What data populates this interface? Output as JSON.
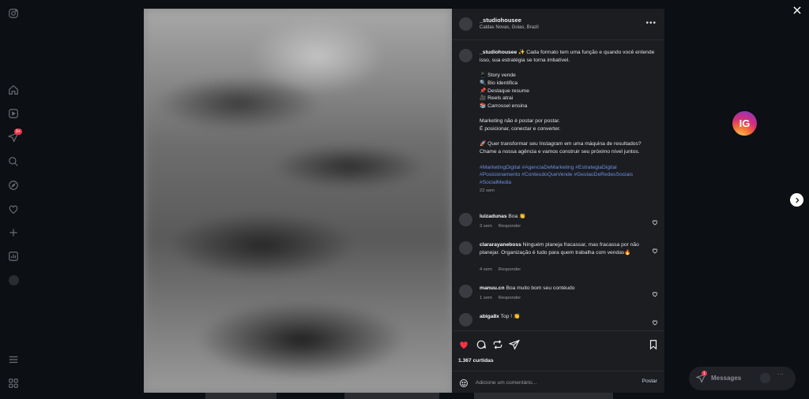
{
  "post": {
    "author": "_studiohousee",
    "location": "Caldas Novas, Goias, Brazil",
    "caption_author": "_studiohousee",
    "caption_intro": "✨ Cada formato tem uma função e quando você entende isso, sua estratégia se torna imbatível.",
    "caption_list": "📱 Story vende\n🔍 Bio identifica\n📌 Destaque resume\n🎥 Reels atrai\n📚 Carrossel ensina",
    "caption_p2": "Marketing não é postar por postar.\nÉ posicionar, conectar e converter.",
    "caption_p3": "🚀 Quer transformar seu Instagram em uma máquina de resultados?\nChame a nossa agência e vamos construir seu próximo nível juntos.",
    "hashtags": "#MarketingDigital #AgenciaDeMarketing #EstrategiaDigital #Posicionamento #ConteudoQueVende #GestaoDeRedesSociais #SocialMedia",
    "caption_age": "22 sem",
    "likes": "1.367 curtidas"
  },
  "comments": [
    {
      "user": "luizadunas",
      "text": "Boa 👏",
      "age": "3 sem",
      "reply": "Responder"
    },
    {
      "user": "clararayaneboss",
      "text": "Ninguém planeja fracassar, mas fracassa por não planejar. Organização é tudo para quem trabalha com vendas🔥",
      "age": "4 sem",
      "reply": "Responder"
    },
    {
      "user": "manuu.cn",
      "text": "Boa muito bom seu contéudo",
      "age": "1 sem",
      "reply": "Responder"
    },
    {
      "user": "abiga8x",
      "text": "Top ! 👏",
      "age": "",
      "reply": ""
    }
  ],
  "composer": {
    "placeholder": "Adicione um comentário...",
    "post_label": "Postar"
  },
  "messages_label": "Messages",
  "messages_badge": "1",
  "ig_badge": "IG",
  "notif_badge": "9+",
  "colors": {
    "like_red": "#ff3040",
    "hashtag_blue": "#6c8fe6",
    "panel_bg": "#1b1d21"
  },
  "icons": [
    "instagram-icon",
    "home-icon",
    "reels-icon",
    "messages-icon",
    "search-icon",
    "explore-icon",
    "heart-icon",
    "create-icon",
    "dashboard-icon",
    "profile-icon",
    "menu-icon",
    "meta-icon"
  ]
}
